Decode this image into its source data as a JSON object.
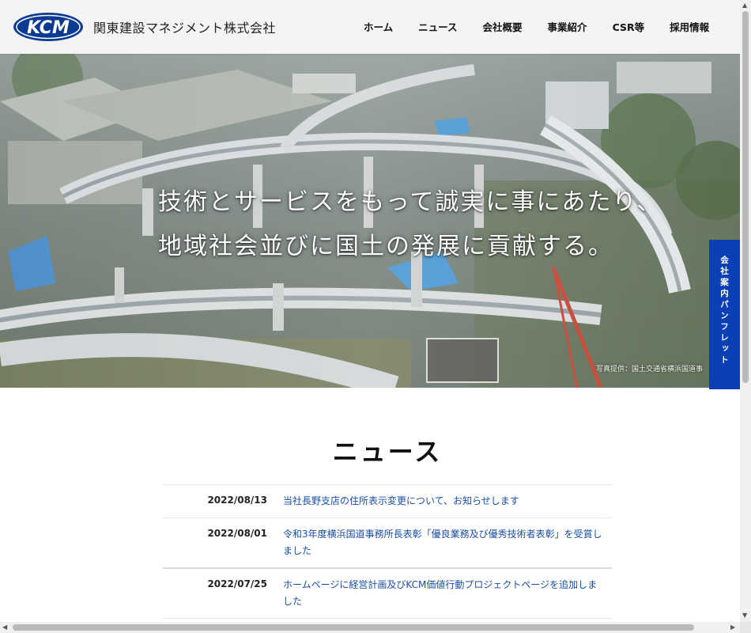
{
  "header": {
    "logo_text": "KCM",
    "company_name": "関東建設マネジメント株式会社",
    "nav": [
      "ホーム",
      "ニュース",
      "会社概要",
      "事業紹介",
      "CSR等",
      "採用情報"
    ]
  },
  "hero": {
    "line1": "技術とサービスをもって誠実に事にあたり、",
    "line2": "地域社会並びに国土の発展に貢献する。",
    "photo_credit": "写真提供：国土交通省横浜国道事"
  },
  "side_tab": {
    "label": "会社案内パンフレット"
  },
  "news": {
    "heading": "ニュース",
    "items": [
      {
        "date": "2022/08/13",
        "title": "当社長野支店の住所表示変更について、お知らせします"
      },
      {
        "date": "2022/08/01",
        "title": "令和3年度横浜国道事務所長表彰「優良業務及び優秀技術者表彰」を受賞しました"
      },
      {
        "date": "2022/07/25",
        "title": "ホームページに経営計画及びKCM価値行動プロジェクトページを追加しました"
      }
    ]
  },
  "colors": {
    "brand_blue": "#0a3fb6",
    "link_blue": "#1a4ea8"
  },
  "icons": [
    "kcm-logo",
    "scroll-up-arrow-icon",
    "scroll-down-arrow-icon",
    "scroll-left-arrow-icon",
    "scroll-right-arrow-icon"
  ]
}
